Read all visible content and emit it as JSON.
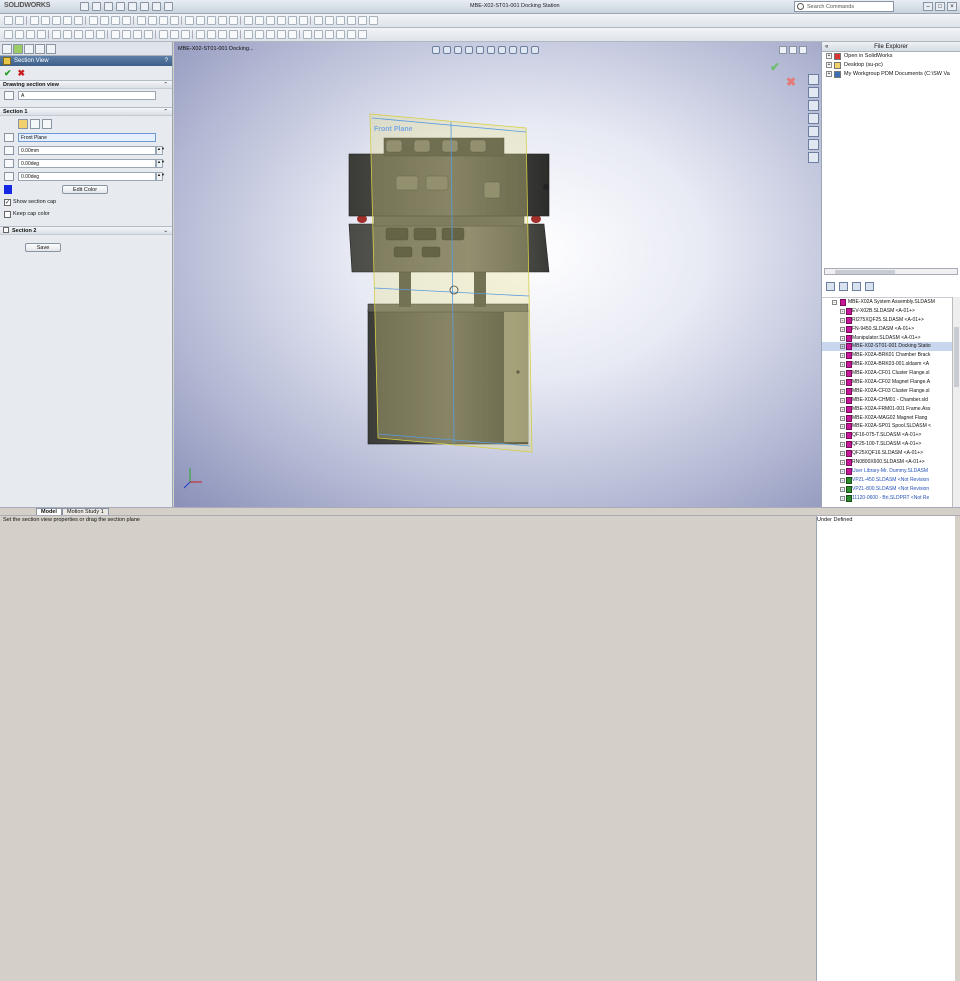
{
  "app": {
    "logo_text": "SOLIDWORKS",
    "doc_title": "MBE-X02-ST01-001 Docking Station"
  },
  "search": {
    "placeholder": "Search Commands"
  },
  "left_panel": {
    "title": "Section View",
    "help": "?",
    "drawing_section_header": "Drawing section view",
    "section_label_value": "A",
    "section1_header": "Section 1",
    "plane_value": "Front Plane",
    "offset_value": "0.00mm",
    "angle1_value": "0.00deg",
    "angle2_value": "0.00deg",
    "edit_color_label": "Edit Color",
    "show_section_cap_label": "Show section cap",
    "keep_cap_color_label": "Keep cap color",
    "section2_header": "Section 2",
    "save_label": "Save",
    "accent_color": "#1428e6"
  },
  "viewport": {
    "tree_label": "MBE-X02-ST01-001 Docking...",
    "plane_label": "Front Plane"
  },
  "file_explorer": {
    "title": "File Explorer",
    "items": [
      "Open in SolidWorks",
      "Desktop (su-pc)",
      "My Workgroup PDM Documents (C:\\SW Va"
    ]
  },
  "pdm_tree": {
    "root": "MBE-X02A System Assembly.SLDASM",
    "items": [
      {
        "label": "EV-X02B.SLDASM <A-01+>",
        "style": ""
      },
      {
        "label": "RI275XQF25.SLDASM <A-01+>",
        "style": ""
      },
      {
        "label": "FN-9450.SLDASM <A-01+>",
        "style": ""
      },
      {
        "label": "Manipulator.SLDASM <A-01+>",
        "style": ""
      },
      {
        "label": "MBE-X02-ST01-001 Docking Statio",
        "style": "hl"
      },
      {
        "label": "MBE-X02A-BRK01 Chamber Brack",
        "style": ""
      },
      {
        "label": "MBE-X02A-BRK03-001.sldasm <A",
        "style": ""
      },
      {
        "label": "MBE-X02A-CF01 Cluster Flange.sl",
        "style": ""
      },
      {
        "label": "MBE-X02A-CF02 Magnet Flange.A",
        "style": ""
      },
      {
        "label": "MBE-X02A-CF03 Cluster Flange.sl",
        "style": ""
      },
      {
        "label": "MBE-X02A-CHM01 - Chamber.sld",
        "style": ""
      },
      {
        "label": "MBE-X02A-FRM01-001 Frame.Ass",
        "style": ""
      },
      {
        "label": "MBE-X02A-MAG02 Magnet Flang",
        "style": ""
      },
      {
        "label": "MBE-X02A-SP01 Spool.SLDASM <",
        "style": ""
      },
      {
        "label": "QF16-075-T.SLDASM <A-01+>",
        "style": ""
      },
      {
        "label": "QF25-100-T.SLDASM <A-01+>",
        "style": ""
      },
      {
        "label": "QF25XQF16.SLDASM <A-01+>",
        "style": ""
      },
      {
        "label": "RN0800X600.SLDASM <A-01+>",
        "style": ""
      },
      {
        "label": "User Library-Mr. Dummy.SLDASM",
        "style": "blue"
      },
      {
        "label": "VPZL-450.SLDASM <Not Revision",
        "style": "blue green"
      },
      {
        "label": "VPZL-800.SLDASM <Not Revision",
        "style": "blue green"
      },
      {
        "label": "11120-0600 - Bri.SLDPRT <Not Re",
        "style": "blue green"
      }
    ]
  },
  "bottom_tabs": [
    "Model",
    "Motion Study 1"
  ],
  "status": {
    "left": "Set the section view properties or drag the section plane",
    "right": "Under Defined"
  }
}
